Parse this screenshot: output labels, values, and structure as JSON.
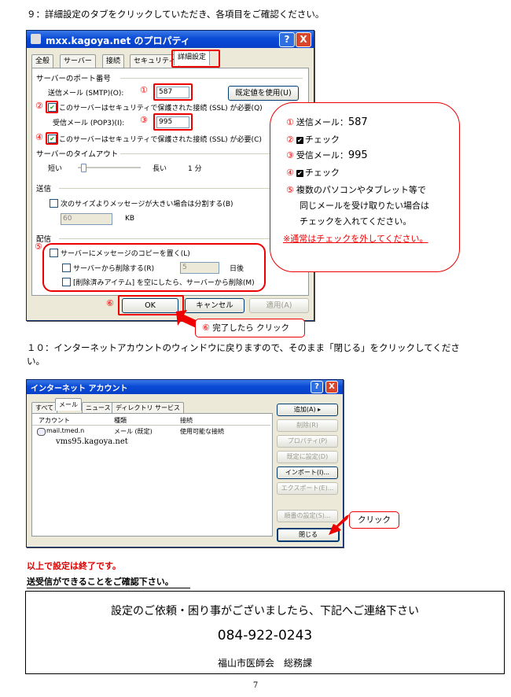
{
  "step9": {
    "text": "９：詳細設定のタブをクリックしていただき、各項目をご確認ください。"
  },
  "props_window": {
    "title": "mxx.kagoya.net のプロパティ",
    "help_btn": "?",
    "close_btn": "X",
    "tabs": [
      "全般",
      "サーバー",
      "接続",
      "セキュリティ",
      "詳細設定"
    ],
    "group_ports": "サーバーのポート番号",
    "smtp_label": "送信メール (SMTP)(O):",
    "smtp_value": "587",
    "default_btn": "既定値を使用(U)",
    "ssl_smtp": "このサーバーはセキュリティで保護された接続 (SSL) が必要(Q)",
    "pop3_label": "受信メール (POP3)(I):",
    "pop3_value": "995",
    "ssl_pop3": "このサーバーはセキュリティで保護された接続 (SSL) が必要(C)",
    "timeout_label": "サーバーのタイムアウト",
    "timeout_short": "短い",
    "timeout_long": "長い",
    "timeout_value": "1 分",
    "timeout_level": 0.05,
    "group_send": "送信",
    "split_label": "次のサイズよりメッセージが大きい場合は分割する(B)",
    "split_value": "60",
    "split_unit": "KB",
    "group_delivery": "配信",
    "leave_copy": "サーバーにメッセージのコピーを置く(L)",
    "remove_label": "サーバーから削除する(R)",
    "remove_value": "5",
    "remove_unit": "日後",
    "remove_deleted": "[削除済みアイテム] を空にしたら、サーバーから削除(M)",
    "ok_btn": "OK",
    "cancel_btn": "キャンセル",
    "apply_btn": "適用(A)",
    "markers": {
      "n1": "①",
      "n2": "②",
      "n3": "③",
      "n4": "④",
      "n5": "⑤",
      "n6": "⑥"
    },
    "check": "✔"
  },
  "callout": {
    "l1_num": "①",
    "l1_text": "送信メール：",
    "l1_val": "587",
    "l2_num": "②",
    "l2_text": "チェック",
    "l3_num": "③",
    "l3_text": "受信メール：",
    "l3_val": "995",
    "l4_num": "④",
    "l4_text": "チェック",
    "l5_num": "⑤",
    "l5_text": "複数のパソコンやタブレット等で",
    "l6_text": "同じメールを受け取りたい場合は",
    "l7_text": "チェックを入れてください。",
    "note": "※通常はチェックを外してください。"
  },
  "done_callout": {
    "num": "⑥",
    "text": "完了したら クリック"
  },
  "step10": {
    "line1": "１０：インターネットアカウントのウィンドウに戻りますので、そのまま「閉じる」をクリックしてくださ",
    "line2": "い。"
  },
  "accounts_window": {
    "title": "インターネット アカウント",
    "tabs": [
      "すべて",
      "メール",
      "ニュース",
      "ディレクトリ サービス"
    ],
    "col_account": "アカウント",
    "col_type": "種類",
    "col_conn": "接続",
    "row_account": "mail.tmed.n",
    "row_type": "メール (既定)",
    "row_conn": "使用可能な接続",
    "row_server": "vms95.kagoya.net",
    "btn_add": "追加(A)",
    "btn_add_arrow": "▸",
    "btn_delete": "削除(R)",
    "btn_props": "プロパティ(P)",
    "btn_default": "既定に設定(D)",
    "btn_import": "インポート(I)...",
    "btn_export": "エクスポート(E)...",
    "btn_order": "順番の設定(S)...",
    "btn_close": "閉じる",
    "click_label": "クリック"
  },
  "finish": {
    "line1": "以上で設定は終了です。",
    "line2": "送受信ができることをご確認下さい。"
  },
  "contact": {
    "line1": "設定のご依頼・困り事がございましたら、下記へご連絡下さい",
    "phone": "084-922-0243",
    "org": "福山市医師会　総務課"
  },
  "page_number": "7"
}
